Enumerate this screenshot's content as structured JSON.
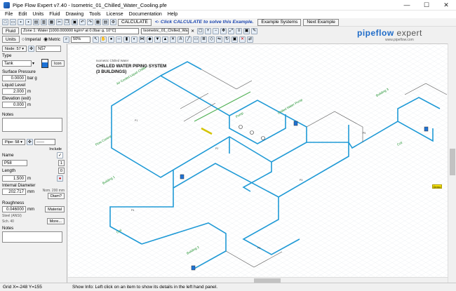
{
  "window": {
    "title": "Pipe Flow Expert v7.40 - Isometric_01_Chilled_Water_Cooling.pfe",
    "minimize": "—",
    "maximize": "☐",
    "close": "✕"
  },
  "menu": [
    "File",
    "Edit",
    "Units",
    "Fluid",
    "Drawing",
    "Tools",
    "License",
    "Documentation",
    "Help"
  ],
  "toolbar": {
    "calculate_label": "CALCULATE",
    "hint": "<- Click CALCULATE to solve this Example.",
    "example_systems_label": "Example Systems",
    "next_example_label": "Next Example"
  },
  "fluid_bar": {
    "fluid_button": "Fluid",
    "fluid_zone": "Zone 1: Water [1000.000000 kg/m³ at 0.0bar g, 10°C]",
    "file_tab": "Isometric_01_Chilled_Water_C",
    "file_tab_close": "✕"
  },
  "units_bar": {
    "units_button": "Units",
    "imperial": "Imperial",
    "metric": "Metric",
    "zoom": "50%"
  },
  "logo": {
    "brand_pipe": "pipe",
    "brand_flow": "flow",
    "brand_expert": "expert",
    "url": "www.pipeflow.com"
  },
  "node_panel": {
    "node_label": "Node:",
    "node_number": "57",
    "node_name": "N57",
    "type_label": "Type",
    "type_value": "Tank",
    "icon_button": "Icon",
    "surface_pressure_label": "Surface Pressure",
    "surface_pressure": "0.0000",
    "surface_pressure_unit": "bar g",
    "liquid_level_label": "Liquid Level",
    "liquid_level": "2.000",
    "liquid_level_unit": "m",
    "elevation_label": "Elevation (exit)",
    "elevation": "0.000",
    "elevation_unit": "m",
    "notes_label": "Notes"
  },
  "pipe_panel": {
    "pipe_label": "Pipe:",
    "pipe_number": "58",
    "include_label": "Include",
    "name_label": "Name",
    "name_value": "P58",
    "length_label": "Length",
    "length_value": "1.500",
    "length_unit": "m",
    "internal_diameter_label": "Internal Diameter",
    "internal_diameter": "202.717",
    "internal_diameter_unit": "mm",
    "nominal_note": "Nom. 200 mm",
    "diam_button": "Diam?",
    "roughness_label": "Roughness",
    "roughness": "0.046000",
    "roughness_unit": "mm",
    "material_button": "Material",
    "material_note_1": "Steel (ANSI)",
    "material_note_2": "Sch. 40",
    "more_button": "More...",
    "notes_label": "Notes",
    "fitting_count": "1",
    "fitting_zero": "0"
  },
  "drawing": {
    "title_small": "Isometric Chilled Water",
    "title_line1": "CHILLED WATER PIPING SYSTEM",
    "title_line2": "(3 BUILDINGS)",
    "badge": "Demo",
    "pipe_color": "#1f9ad6",
    "green_color": "#4caf50",
    "label_color": "#1a8f2a"
  },
  "status": {
    "grid": "Grid  X=-248  Y=155",
    "info": "Show Info: Left click on an item to show its details in the left hand panel."
  },
  "colors": {
    "accent": "#1e6bc8",
    "pipe": "#1f9ad6"
  }
}
